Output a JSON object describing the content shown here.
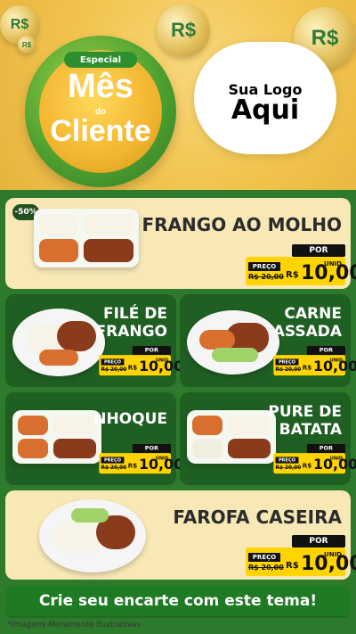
{
  "hero": {
    "badge": {
      "top_ribbon": "Especial",
      "title_line1": "Mês",
      "title_do": "do",
      "title_line2": "Cliente"
    },
    "logo_placeholder": {
      "line1": "Sua Logo",
      "line2": "Aqui"
    },
    "coin_sign": "R$"
  },
  "products": [
    {
      "name": "FRANGO AO MOLHO",
      "discount_badge": "-50%",
      "price": {
        "por_label": "POR",
        "preco_label": "PREÇO",
        "old_value": "R$ 20,00",
        "currency": "R$",
        "value": "10,00",
        "unit": "UNID"
      }
    },
    {
      "name_line1": "FILÉ DE",
      "name_line2": "FRANGO",
      "price": {
        "por_label": "POR",
        "preco_label": "PREÇO",
        "old_value": "R$ 20,00",
        "currency": "R$",
        "value": "10,00",
        "unit": "UNID"
      }
    },
    {
      "name_line1": "CARNE",
      "name_line2": "ASSADA",
      "price": {
        "por_label": "POR",
        "preco_label": "PREÇO",
        "old_value": "R$ 20,00",
        "currency": "R$",
        "value": "10,00",
        "unit": "UNID"
      }
    },
    {
      "name": "NHOQUE",
      "price": {
        "por_label": "POR",
        "preco_label": "PREÇO",
        "old_value": "R$ 20,00",
        "currency": "R$",
        "value": "10,00",
        "unit": "UNID"
      }
    },
    {
      "name_line1": "PURE DE",
      "name_line2": "BATATA",
      "price": {
        "por_label": "POR",
        "preco_label": "PREÇO",
        "old_value": "R$ 20,00",
        "currency": "R$",
        "value": "10,00",
        "unit": "UNID"
      }
    },
    {
      "name": "FAROFA CASEIRA",
      "price": {
        "por_label": "POR",
        "preco_label": "PREÇO",
        "old_value": "R$ 20,00",
        "currency": "R$",
        "value": "10,00",
        "unit": "UNID"
      }
    }
  ],
  "cta": {
    "label": "Crie seu encarte com este tema!"
  },
  "footnote": "*Imagens Meramente Ilustrativas",
  "colors": {
    "primary_green": "#2e7a2c",
    "dark_green": "#1f5f22",
    "cream": "#f7e8b6",
    "gold": "#f1c34d",
    "price_yellow": "#ffd400"
  }
}
